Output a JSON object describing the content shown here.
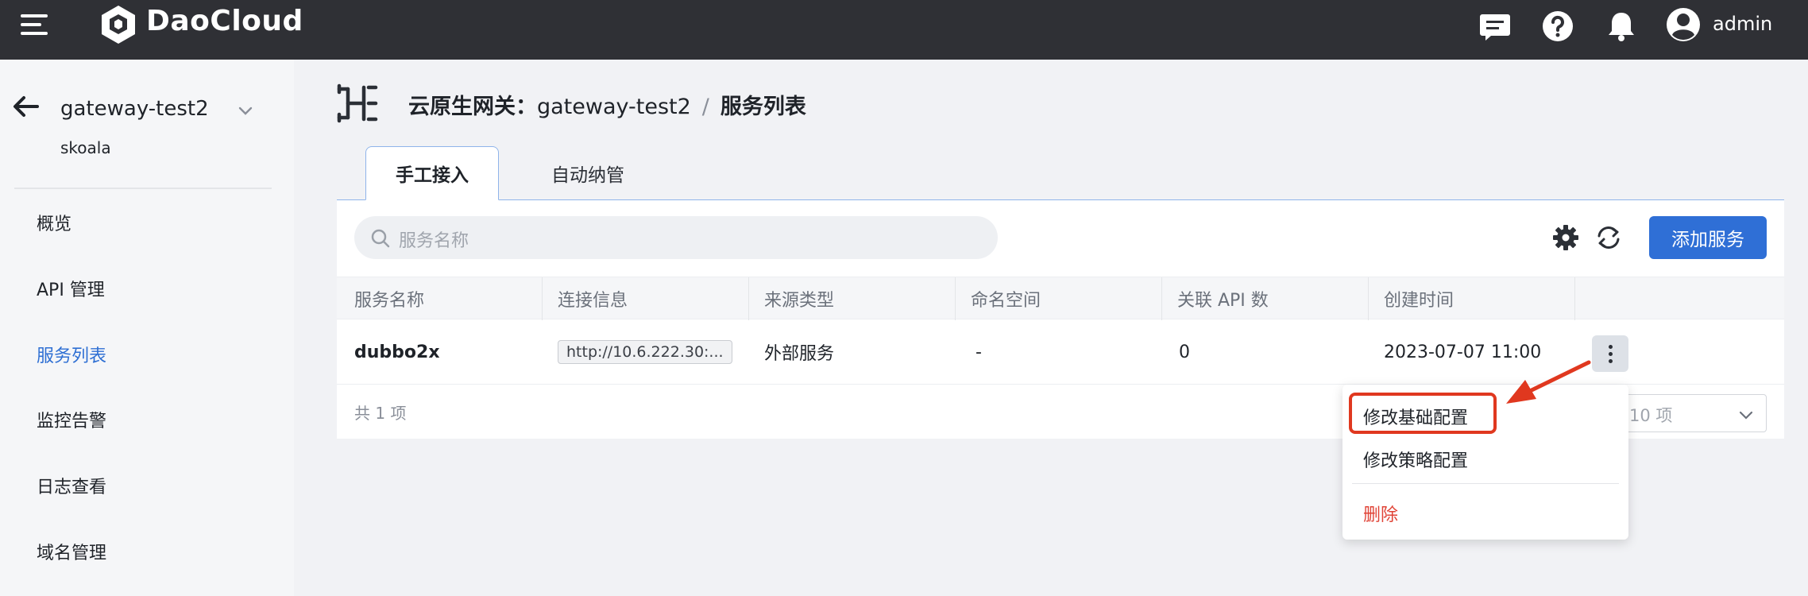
{
  "topbar": {
    "brand": "DaoCloud",
    "user": "admin",
    "icons": [
      "menu-icon",
      "chat-icon",
      "help-icon",
      "bell-icon",
      "user-avatar-icon"
    ]
  },
  "sidebar": {
    "workspace": "gateway-test2",
    "workspace_sub": "skoala",
    "items": [
      {
        "label": "概览",
        "active": false
      },
      {
        "label": "API 管理",
        "active": false
      },
      {
        "label": "服务列表",
        "active": true
      },
      {
        "label": "监控告警",
        "active": false
      },
      {
        "label": "日志查看",
        "active": false
      },
      {
        "label": "域名管理",
        "active": false
      }
    ]
  },
  "breadcrumb": {
    "label": "云原生网关：",
    "gateway": "gateway-test2",
    "separator": "/",
    "current": "服务列表"
  },
  "tabs": [
    {
      "label": "手工接入",
      "active": true
    },
    {
      "label": "自动纳管",
      "active": false
    }
  ],
  "toolbar": {
    "search_placeholder": "服务名称",
    "add_label": "添加服务"
  },
  "table": {
    "columns": [
      "服务名称",
      "连接信息",
      "来源类型",
      "命名空间",
      "关联 API 数",
      "创建时间"
    ],
    "rows": [
      {
        "name": "dubbo2x",
        "connection": "http://10.6.222.30:...",
        "source": "外部服务",
        "namespace": "-",
        "api_count": "0",
        "created": "2023-07-07 11:00"
      }
    ]
  },
  "footer": {
    "total": "共 1 项",
    "page_size": "10 项"
  },
  "menu": {
    "items": [
      {
        "label": "修改基础配置"
      },
      {
        "label": "修改策略配置"
      },
      {
        "label": "删除",
        "danger": true
      }
    ]
  },
  "colors": {
    "topbar": "#2f3035",
    "accent": "#2f6fd6",
    "danger": "#e04336",
    "highlight": "#e0381f"
  }
}
